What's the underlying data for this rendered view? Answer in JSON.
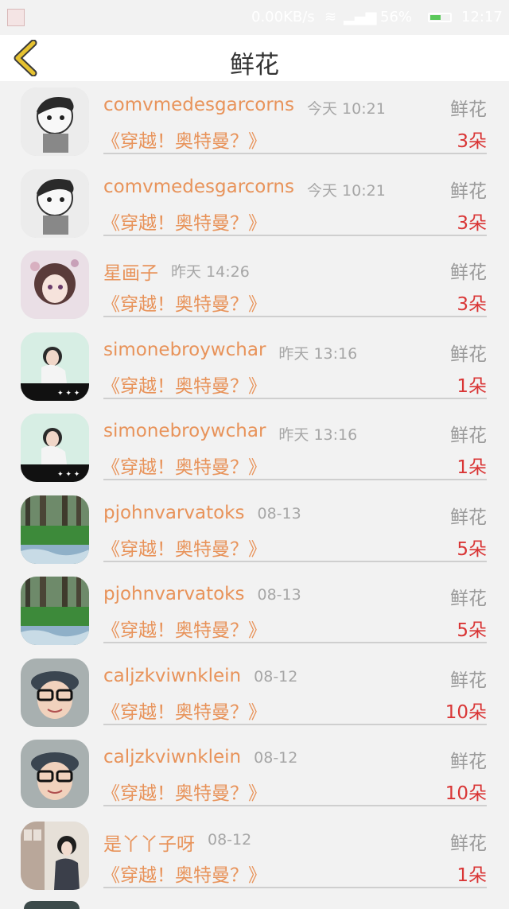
{
  "status_bar": {
    "speed": "0.00KB/s",
    "battery_percent": "56%",
    "time": "12:17",
    "battery_level": 0.56,
    "icons": [
      "app-notification-icon",
      "wifi-icon",
      "signal-icon",
      "battery-icon"
    ]
  },
  "header": {
    "title": "鲜花",
    "back_icon": "chevron-left-icon"
  },
  "rows": [
    {
      "name": "comvmedesgarcorns",
      "time": "今天 10:21",
      "gift": "鲜花",
      "work": "《穿越！奥特曼？》",
      "count": "3朵",
      "avatar": "cartoon-boy-avatar"
    },
    {
      "name": "comvmedesgarcorns",
      "time": "今天 10:21",
      "gift": "鲜花",
      "work": "《穿越！奥特曼？》",
      "count": "3朵",
      "avatar": "cartoon-boy-avatar"
    },
    {
      "name": "星画子",
      "time": "昨天 14:26",
      "gift": "鲜花",
      "work": "《穿越！奥特曼？》",
      "count": "3朵",
      "avatar": "anime-girl-avatar"
    },
    {
      "name": "simonebroywchar",
      "time": "昨天 13:16",
      "gift": "鲜花",
      "work": "《穿越！奥特曼？》",
      "count": "1朵",
      "avatar": "photo-girl-avatar"
    },
    {
      "name": "simonebroywchar",
      "time": "昨天 13:16",
      "gift": "鲜花",
      "work": "《穿越！奥特曼？》",
      "count": "1朵",
      "avatar": "photo-girl-avatar"
    },
    {
      "name": "pjohnvarvatoks",
      "time": "08-13",
      "gift": "鲜花",
      "work": "《穿越！奥特曼？》",
      "count": "5朵",
      "avatar": "forest-avatar"
    },
    {
      "name": "pjohnvarvatoks",
      "time": "08-13",
      "gift": "鲜花",
      "work": "《穿越！奥特曼？》",
      "count": "5朵",
      "avatar": "forest-avatar"
    },
    {
      "name": "caljzkviwnklein",
      "time": "08-12",
      "gift": "鲜花",
      "work": "《穿越！奥特曼？》",
      "count": "10朵",
      "avatar": "boy-cap-avatar"
    },
    {
      "name": "caljzkviwnklein",
      "time": "08-12",
      "gift": "鲜花",
      "work": "《穿越！奥特曼？》",
      "count": "10朵",
      "avatar": "boy-cap-avatar"
    },
    {
      "name": "是丫丫子呀",
      "time": "08-12",
      "gift": "鲜花",
      "work": "《穿越！奥特曼？》",
      "count": "1朵",
      "avatar": "girl-room-avatar"
    }
  ],
  "colors": {
    "name": "#e8935a",
    "count": "#d93535",
    "back_arrow": "#e6c230",
    "background": "#f2f2f2"
  }
}
